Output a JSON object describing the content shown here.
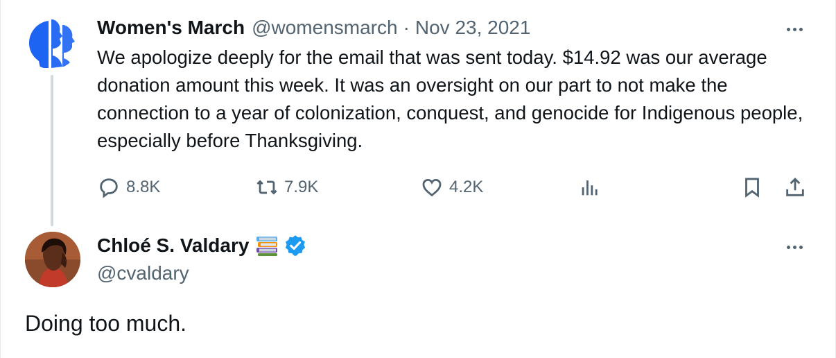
{
  "parent_tweet": {
    "author_name": "Women's March",
    "handle": "@womensmarch",
    "separator": "·",
    "date": "Nov 23, 2021",
    "text": "We apologize deeply for the email that was sent today. $14.92 was our average donation amount this week. It was an oversight on our part to not make the connection to a year of colonization, conquest, and genocide for Indigenous people, especially before Thanksgiving.",
    "avatar_icon": "womens-march-logo",
    "stats": {
      "replies": "8.8K",
      "reposts": "7.9K",
      "likes": "4.2K"
    }
  },
  "tweet": {
    "author_name": "Chloé S. Valdary",
    "handle": "@cvaldary",
    "name_emoji": "books-emoji",
    "verified": true,
    "text": "Doing too much."
  },
  "colors": {
    "brand_blue": "#1d64f2",
    "verified_blue": "#1d9bf0",
    "muted_text": "#536471",
    "thread_line": "#cfd9de"
  }
}
